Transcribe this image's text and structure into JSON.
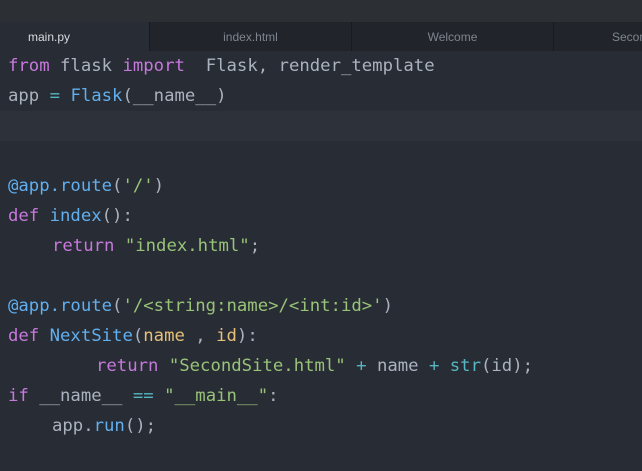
{
  "tabs": [
    {
      "label": "main.py",
      "active": true
    },
    {
      "label": "index.html",
      "active": false
    },
    {
      "label": "Welcome",
      "active": false
    },
    {
      "label": "Secon",
      "active": false
    }
  ],
  "code": {
    "l1": {
      "from": "from",
      "mod": " flask ",
      "import": "import",
      "rest": "  Flask, render_template"
    },
    "l2": {
      "app": "app ",
      "eq": "=",
      "sp": " ",
      "Flask": "Flask",
      "args": "(__name__)"
    },
    "l5": {
      "decorator": "@app.route",
      "open": "(",
      "path": "'/'",
      "close": ")"
    },
    "l6": {
      "def": "def",
      "sp": " ",
      "name": "index",
      "rest": "():"
    },
    "l7": {
      "ret": "return",
      "sp": " ",
      "val": "\"index.html\"",
      "semi": ";"
    },
    "l9": {
      "decorator": "@app.route",
      "open": "(",
      "path": "'/<string:name>/<int:id>'",
      "close": ")"
    },
    "l10": {
      "def": "def",
      "sp": " ",
      "name": "NextSite",
      "open": "(",
      "p1": "name",
      "comma": " , ",
      "p2": "id",
      "close": "):"
    },
    "l11": {
      "ret": "return",
      "sp": " ",
      "val": "\"SecondSite.html\"",
      "plus1": " + ",
      "name": "name",
      "plus2": " + ",
      "str": "str",
      "args": "(id);"
    },
    "l12": {
      "if": "if",
      "cond": " __name__ ",
      "eq": "==",
      "sp": " ",
      "val": "\"__main__\"",
      "colon": ":"
    },
    "l13": {
      "app": "app.",
      "run": "run",
      "rest": "();"
    }
  },
  "colors": {
    "background": "#282c34",
    "keyword": "#c678dd",
    "function": "#61afef",
    "string": "#98c379",
    "parameter": "#e5c07b",
    "operator": "#56b6c2",
    "default": "#abb2bf"
  }
}
